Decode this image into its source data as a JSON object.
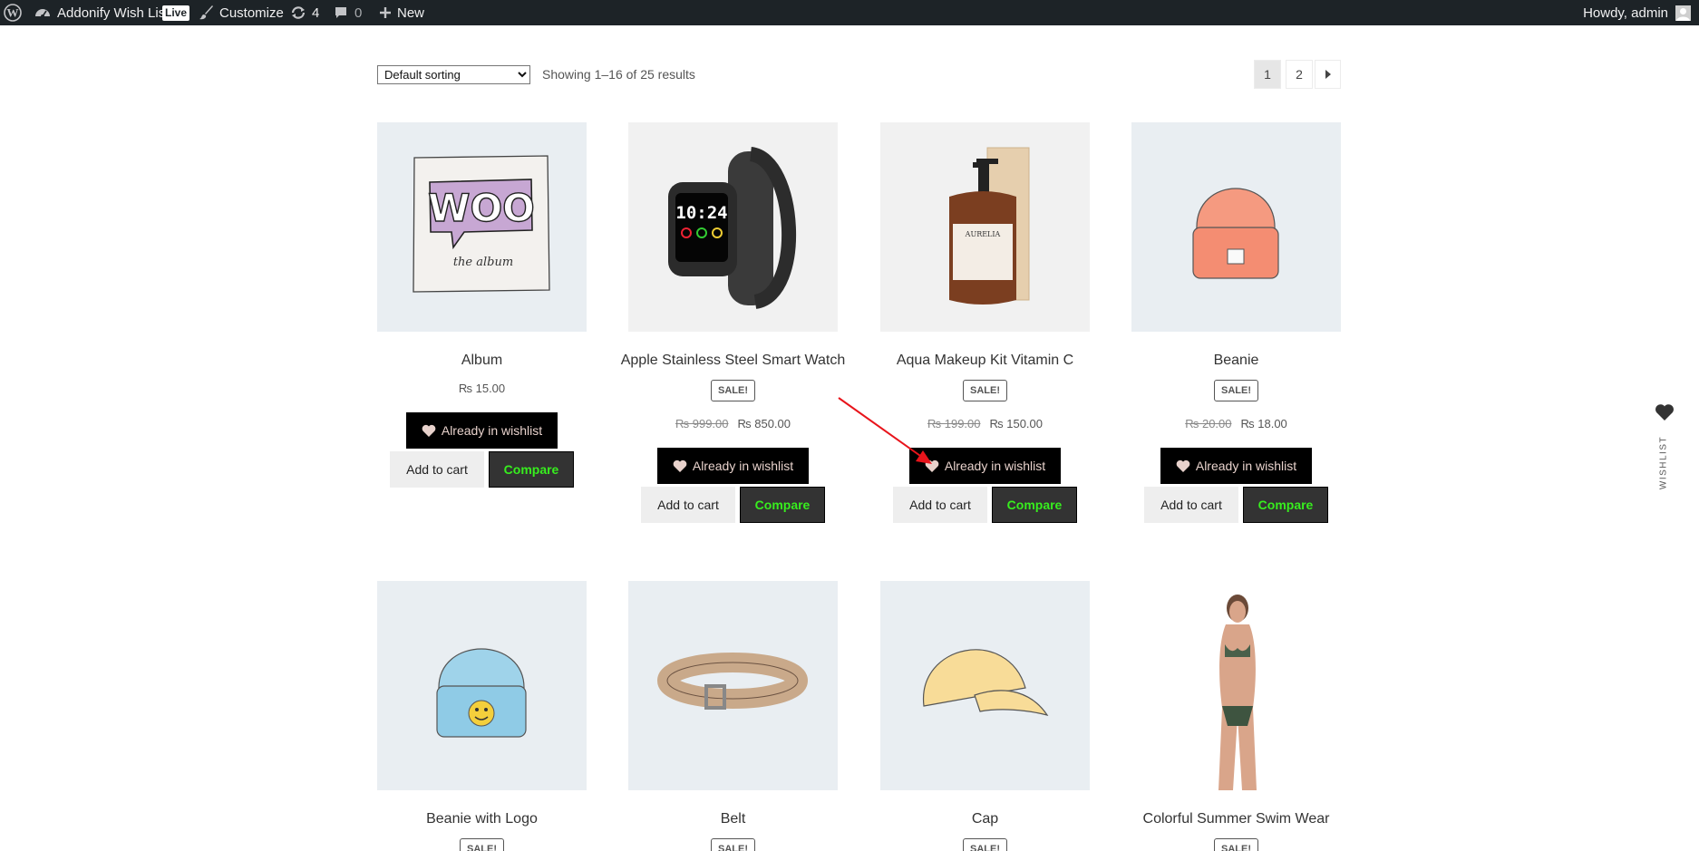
{
  "admin_bar": {
    "site_name": "Addonify Wish List",
    "live_label": "Live",
    "customize_label": "Customize",
    "updates_count": "4",
    "comments_count": "0",
    "new_label": "New",
    "greeting": "Howdy, admin"
  },
  "toolbar": {
    "sort_selected": "Default sorting",
    "result_count": "Showing 1–16 of 25 results",
    "pages": [
      "1",
      "2"
    ],
    "current_page": "1"
  },
  "products": [
    {
      "title": "Album",
      "sale": "",
      "old_price": "",
      "price": "₨ 15.00",
      "wishlist_label": "Already in wishlist",
      "cart_label": "Add to cart",
      "compare_label": "Compare"
    },
    {
      "title": "Apple Stainless Steel Smart Watch",
      "sale": "SALE!",
      "old_price": "₨ 999.00",
      "price": "₨ 850.00",
      "wishlist_label": "Already in wishlist",
      "cart_label": "Add to cart",
      "compare_label": "Compare"
    },
    {
      "title": "Aqua Makeup Kit Vitamin C",
      "sale": "SALE!",
      "old_price": "₨ 199.00",
      "price": "₨ 150.00",
      "wishlist_label": "Already in wishlist",
      "cart_label": "Add to cart",
      "compare_label": "Compare"
    },
    {
      "title": "Beanie",
      "sale": "SALE!",
      "old_price": "₨ 20.00",
      "price": "₨ 18.00",
      "wishlist_label": "Already in wishlist",
      "cart_label": "Add to cart",
      "compare_label": "Compare"
    },
    {
      "title": "Beanie with Logo",
      "sale": "SALE!"
    },
    {
      "title": "Belt",
      "sale": "SALE!"
    },
    {
      "title": "Cap",
      "sale": "SALE!"
    },
    {
      "title": "Colorful Summer Swim Wear",
      "sale": "SALE!"
    }
  ],
  "product_images": {
    "album_text_top": "WOO",
    "album_text_bottom": "the album",
    "watch_time": "10:24",
    "bottle_brand": "AURELIA"
  },
  "wishlist_sidebar": {
    "label": "WISHLIST"
  },
  "colors": {
    "admin_bar": "#1d2327",
    "wishlist_button": "#000000",
    "compare_text": "#37ee1e",
    "annotation_arrow": "#e8141b"
  }
}
